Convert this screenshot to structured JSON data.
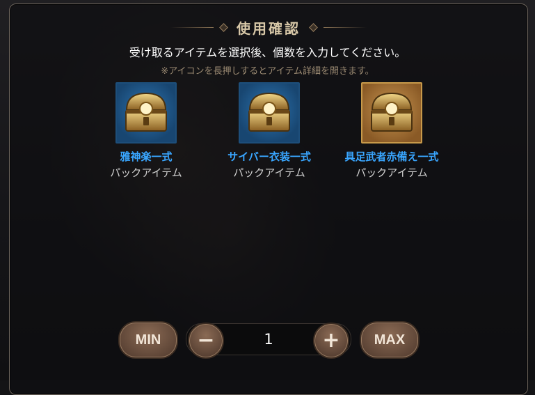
{
  "dialog": {
    "title": "使用確認",
    "instruction": "受け取るアイテムを選択後、個数を入力してください。",
    "note": "※アイコンを長押しするとアイテム詳細を開きます。"
  },
  "items": [
    {
      "name": "雅神楽一式",
      "type": "パックアイテム",
      "icon": "treasure-chest-icon",
      "frame_color": "#1d4e7a"
    },
    {
      "name": "サイバー衣装一式",
      "type": "パックアイテム",
      "icon": "treasure-chest-icon",
      "frame_color": "#1d4e7a"
    },
    {
      "name": "具足武者赤備え一式",
      "type": "パックアイテム",
      "icon": "treasure-chest-icon",
      "frame_color": "#c89a4a"
    }
  ],
  "quantity": {
    "min_label": "MIN",
    "max_label": "MAX",
    "decrement_label": "−",
    "increment_label": "+",
    "value": "1"
  },
  "colors": {
    "item_name": "#39a6ff",
    "title": "#d8c8a8",
    "note": "#9b8a72",
    "button": "#6f5443"
  }
}
